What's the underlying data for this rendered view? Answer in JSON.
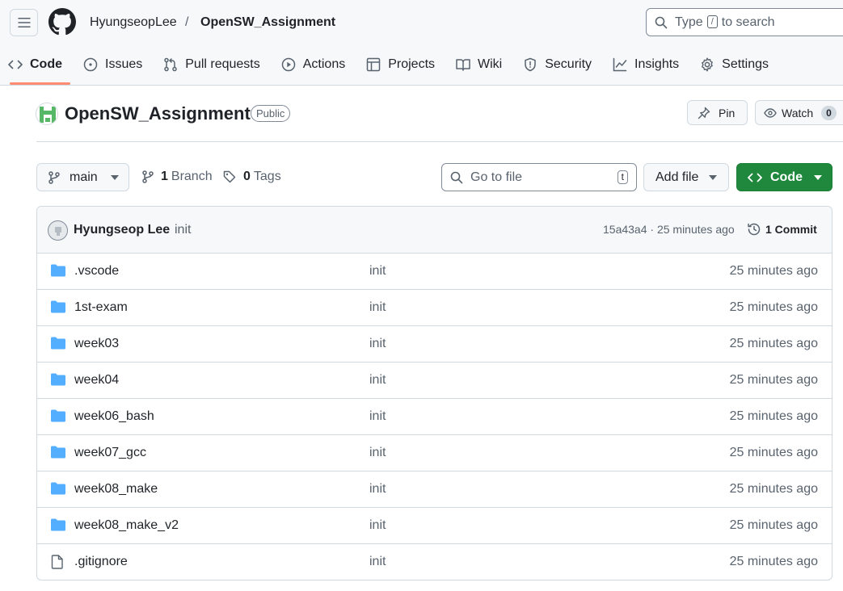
{
  "header": {
    "owner": "HyungseopLee",
    "separator": "/",
    "repo": "OpenSW_Assignment",
    "search": {
      "prefix": "Type",
      "key": "/",
      "suffix": "to search"
    }
  },
  "nav": [
    {
      "label": "Code",
      "icon": "code-icon",
      "active": true
    },
    {
      "label": "Issues",
      "icon": "issue-icon"
    },
    {
      "label": "Pull requests",
      "icon": "pull-request-icon"
    },
    {
      "label": "Actions",
      "icon": "play-icon"
    },
    {
      "label": "Projects",
      "icon": "table-icon"
    },
    {
      "label": "Wiki",
      "icon": "book-icon"
    },
    {
      "label": "Security",
      "icon": "shield-icon"
    },
    {
      "label": "Insights",
      "icon": "graph-icon"
    },
    {
      "label": "Settings",
      "icon": "gear-icon"
    }
  ],
  "repo": {
    "title": "OpenSW_Assignment",
    "visibility": "Public",
    "pin_label": "Pin",
    "watch_label": "Watch",
    "watch_count": "0"
  },
  "toolbar": {
    "branch": "main",
    "branch_count": "1",
    "branch_label": "Branch",
    "tag_count": "0",
    "tag_label": "Tags",
    "goto_placeholder": "Go to file",
    "goto_key": "t",
    "add_file_label": "Add file",
    "code_label": "Code"
  },
  "latest_commit": {
    "author": "Hyungseop Lee",
    "message": "init",
    "hash_time": "15a43a4 · 25 minutes ago",
    "commit_count_label": "1 Commit"
  },
  "files": [
    {
      "name": ".vscode",
      "type": "folder",
      "message": "init",
      "age": "25 minutes ago"
    },
    {
      "name": "1st-exam",
      "type": "folder",
      "message": "init",
      "age": "25 minutes ago"
    },
    {
      "name": "week03",
      "type": "folder",
      "message": "init",
      "age": "25 minutes ago"
    },
    {
      "name": "week04",
      "type": "folder",
      "message": "init",
      "age": "25 minutes ago"
    },
    {
      "name": "week06_bash",
      "type": "folder",
      "message": "init",
      "age": "25 minutes ago"
    },
    {
      "name": "week07_gcc",
      "type": "folder",
      "message": "init",
      "age": "25 minutes ago"
    },
    {
      "name": "week08_make",
      "type": "folder",
      "message": "init",
      "age": "25 minutes ago"
    },
    {
      "name": "week08_make_v2",
      "type": "folder",
      "message": "init",
      "age": "25 minutes ago"
    },
    {
      "name": ".gitignore",
      "type": "file",
      "message": "init",
      "age": "25 minutes ago"
    }
  ],
  "colors": {
    "accent_green": "#1f883d",
    "folder_blue": "#54aeff",
    "active_underline": "#fd8c73"
  }
}
